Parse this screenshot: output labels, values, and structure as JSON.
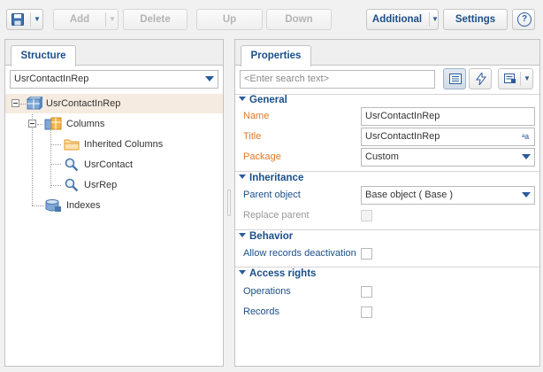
{
  "toolbar": {
    "add_label": "Add",
    "delete_label": "Delete",
    "up_label": "Up",
    "down_label": "Down",
    "additional_label": "Additional",
    "settings_label": "Settings",
    "caret_glyph": "▼",
    "help_glyph": "?"
  },
  "structure": {
    "tab_label": "Structure",
    "selector_value": "UsrContactInRep",
    "tree": {
      "root": "UsrContactInRep",
      "columns": "Columns",
      "inherited_columns": "Inherited Columns",
      "usr_contact": "UsrContact",
      "usr_rep": "UsrRep",
      "indexes": "Indexes"
    }
  },
  "properties": {
    "tab_label": "Properties",
    "search_placeholder": "<Enter search text>",
    "sections": {
      "general": "General",
      "inheritance": "Inheritance",
      "behavior": "Behavior",
      "access_rights": "Access rights"
    },
    "fields": {
      "name_label": "Name",
      "name_value": "UsrContactInRep",
      "title_label": "Title",
      "title_value": "UsrContactInRep",
      "package_label": "Package",
      "package_value": "Custom",
      "parent_object_label": "Parent object",
      "parent_object_value": "Base object ( Base )",
      "replace_parent_label": "Replace parent",
      "allow_deactivation_label": "Allow records deactivation",
      "operations_label": "Operations",
      "records_label": "Records"
    },
    "lang_glyph": "ᵃa"
  },
  "colors": {
    "accent": "#1b4f8a",
    "required_label": "#e07a2a",
    "selected_row": "#f6ebe0"
  }
}
